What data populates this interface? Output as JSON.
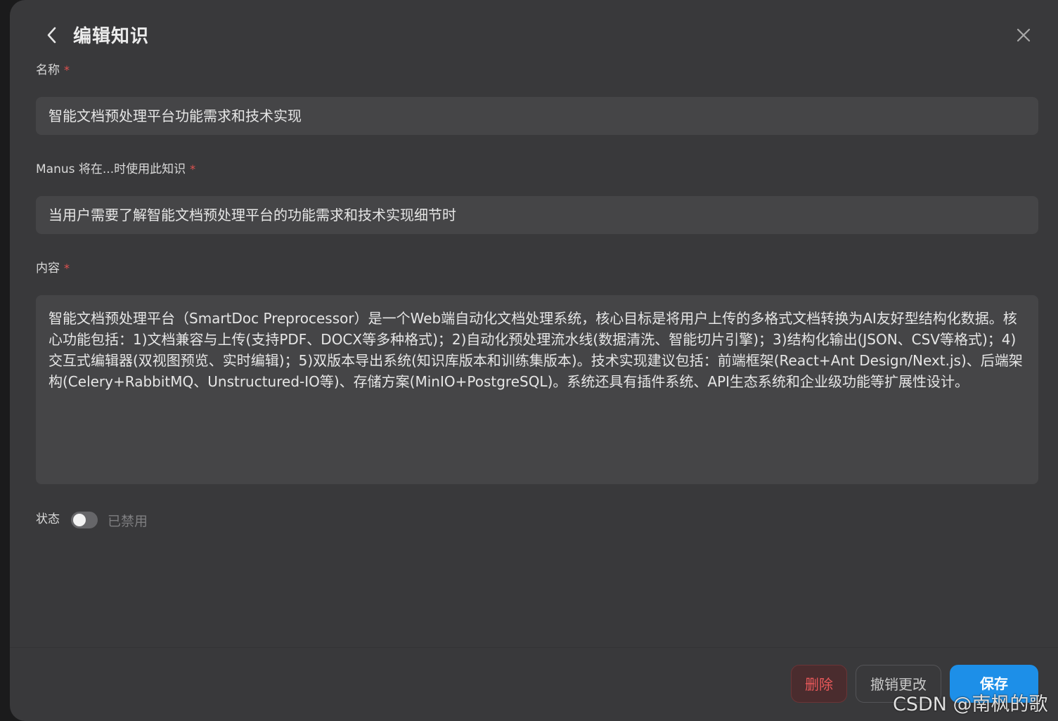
{
  "dialog": {
    "title": "编辑知识",
    "back_icon": "chevron-left-icon",
    "close_icon": "close-icon"
  },
  "fields": {
    "name": {
      "label": "名称",
      "required_mark": "*",
      "value": "智能文档预处理平台功能需求和技术实现"
    },
    "trigger": {
      "label": "Manus 将在...时使用此知识",
      "required_mark": "*",
      "value": "当用户需要了解智能文档预处理平台的功能需求和技术实现细节时"
    },
    "content": {
      "label": "内容",
      "required_mark": "*",
      "value": "智能文档预处理平台（SmartDoc Preprocessor）是一个Web端自动化文档处理系统，核心目标是将用户上传的多格式文档转换为AI友好型结构化数据。核心功能包括：1)文档兼容与上传(支持PDF、DOCX等多种格式)；2)自动化预处理流水线(数据清洗、智能切片引擎)；3)结构化输出(JSON、CSV等格式)；4)交互式编辑器(双视图预览、实时编辑)；5)双版本导出系统(知识库版本和训练集版本)。技术实现建议包括：前端框架(React+Ant Design/Next.js)、后端架构(Celery+RabbitMQ、Unstructured-IO等)、存储方案(MinIO+PostgreSQL)。系统还具有插件系统、API生态系统和企业级功能等扩展性设计。"
    }
  },
  "status": {
    "label": "状态",
    "enabled": false,
    "state_text": "已禁用"
  },
  "footer": {
    "delete_label": "删除",
    "revert_label": "撤销更改",
    "save_label": "保存"
  },
  "watermark": "CSDN @南枫的歌",
  "colors": {
    "background": "#39393b",
    "input": "#454547",
    "accent": "#1d8fe8",
    "danger": "#e8585a",
    "required": "#e0524f"
  }
}
